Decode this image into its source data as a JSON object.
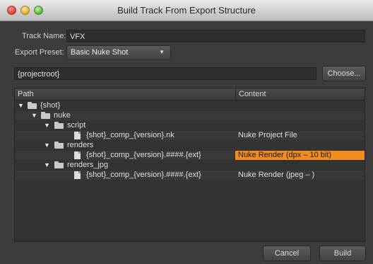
{
  "window": {
    "title": "Build Track From Export Structure"
  },
  "form": {
    "track_name_label": "Track Name:",
    "track_name_value": "VFX",
    "export_preset_label": "Export Preset:",
    "export_preset_value": "Basic Nuke Shot",
    "path_value": "{projectroot}",
    "choose_label": "Choose..."
  },
  "tree": {
    "col_path": "Path",
    "col_content": "Content",
    "rows": [
      {
        "label": "{shot}",
        "content": ""
      },
      {
        "label": "nuke",
        "content": ""
      },
      {
        "label": "script",
        "content": ""
      },
      {
        "label": "{shot}_comp_{version}.nk",
        "content": "Nuke Project File"
      },
      {
        "label": "renders",
        "content": ""
      },
      {
        "label": "{shot}_comp_{version}.####.{ext}",
        "content": "Nuke Render (dpx – 10 bit)"
      },
      {
        "label": "renders_jpg",
        "content": ""
      },
      {
        "label": "{shot}_comp_{version}.####.{ext}",
        "content": "Nuke Render (jpeg – )"
      }
    ]
  },
  "footer": {
    "cancel_label": "Cancel",
    "build_label": "Build"
  },
  "colors": {
    "highlight": "#f28c1c",
    "background": "#3c3c3c"
  }
}
